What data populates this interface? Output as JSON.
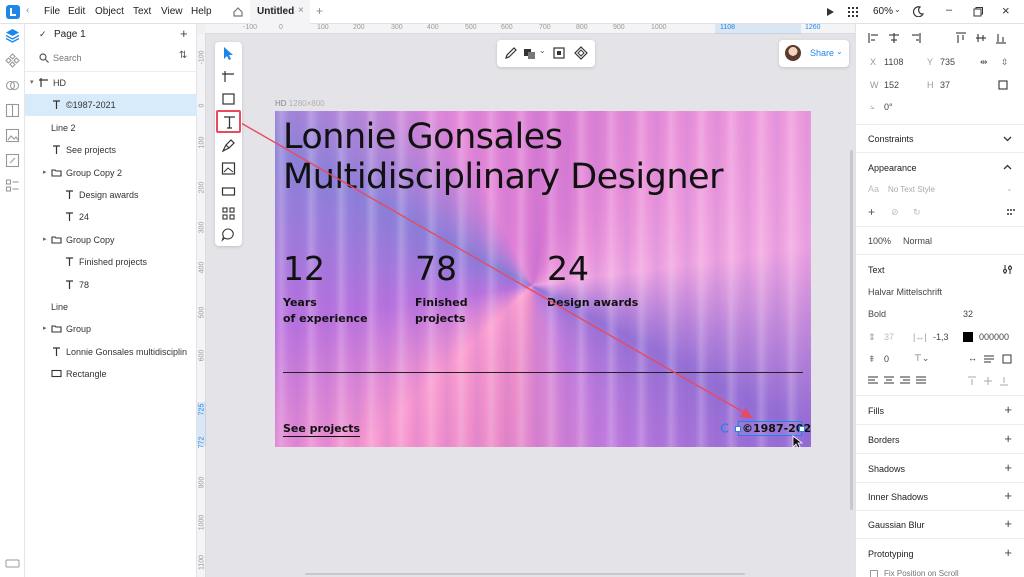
{
  "app": {
    "logo": "Lunacy logo",
    "menu": [
      "File",
      "Edit",
      "Object",
      "Text",
      "View",
      "Help"
    ],
    "tab_title": "Untitled",
    "zoom": "60%"
  },
  "ruler_top": [
    "-100",
    "0",
    "100",
    "200",
    "300",
    "400",
    "500",
    "600",
    "700",
    "800",
    "900",
    "1000",
    "1108",
    "1260"
  ],
  "ruler_left": [
    "-100",
    "0",
    "100",
    "200",
    "300",
    "400",
    "500",
    "600",
    "725",
    "772",
    "900",
    "1000",
    "1100"
  ],
  "pages": {
    "current": "Page 1",
    "search_placeholder": "Search"
  },
  "layers": [
    {
      "name": "HD",
      "icon": "artboard",
      "indent": 0,
      "caret": true
    },
    {
      "name": "©1987-2021",
      "icon": "text",
      "indent": 1,
      "selected": true
    },
    {
      "name": "Line 2",
      "icon": "line",
      "indent": 1
    },
    {
      "name": "See projects",
      "icon": "text",
      "indent": 1
    },
    {
      "name": "Group Copy 2",
      "icon": "folder",
      "indent": 1,
      "caret": true
    },
    {
      "name": "Design awards",
      "icon": "text",
      "indent": 2
    },
    {
      "name": "24",
      "icon": "text",
      "indent": 2
    },
    {
      "name": "Group Copy",
      "icon": "folder",
      "indent": 1,
      "caret": true
    },
    {
      "name": "Finished projects",
      "icon": "text",
      "indent": 2
    },
    {
      "name": "78",
      "icon": "text",
      "indent": 2
    },
    {
      "name": "Line",
      "icon": "line",
      "indent": 1
    },
    {
      "name": "Group",
      "icon": "folder",
      "indent": 1,
      "caret": true
    },
    {
      "name": "Lonnie Gonsales multidisciplin",
      "icon": "text",
      "indent": 1
    },
    {
      "name": "Rectangle",
      "icon": "rect",
      "indent": 1
    }
  ],
  "artboard": {
    "label": "HD",
    "size": "1280×800",
    "title_line1": "Lonnie Gonsales",
    "title_line2": "Multidisciplinary Designer",
    "stats": [
      {
        "number": "12",
        "line1": "Years",
        "line2": "of experience"
      },
      {
        "number": "78",
        "line1": "Finished",
        "line2": "projects"
      },
      {
        "number": "24",
        "line1": "Design awards",
        "line2": ""
      }
    ],
    "link": "See projects",
    "copyright": "©1987-202"
  },
  "share_label": "Share",
  "panel": {
    "x_label": "X",
    "x": "1108",
    "y_label": "Y",
    "y": "735",
    "w_label": "W",
    "w": "152",
    "h_label": "H",
    "h": "37",
    "rotation": "0°",
    "constraints": "Constraints",
    "appearance": "Appearance",
    "text_style": "No Text Style",
    "opacity": "100%",
    "blend": "Normal",
    "text": "Text",
    "font": "Halvar Mittelschrift",
    "weight": "Bold",
    "size": "32",
    "line_height": "37",
    "spacing": "-1,3",
    "color": "000000",
    "para": "0",
    "fills": "Fills",
    "borders": "Borders",
    "shadows": "Shadows",
    "inner_shadows": "Inner Shadows",
    "blur": "Gaussian Blur",
    "prototyping": "Prototyping",
    "fix_scroll": "Fix Position on Scroll"
  }
}
